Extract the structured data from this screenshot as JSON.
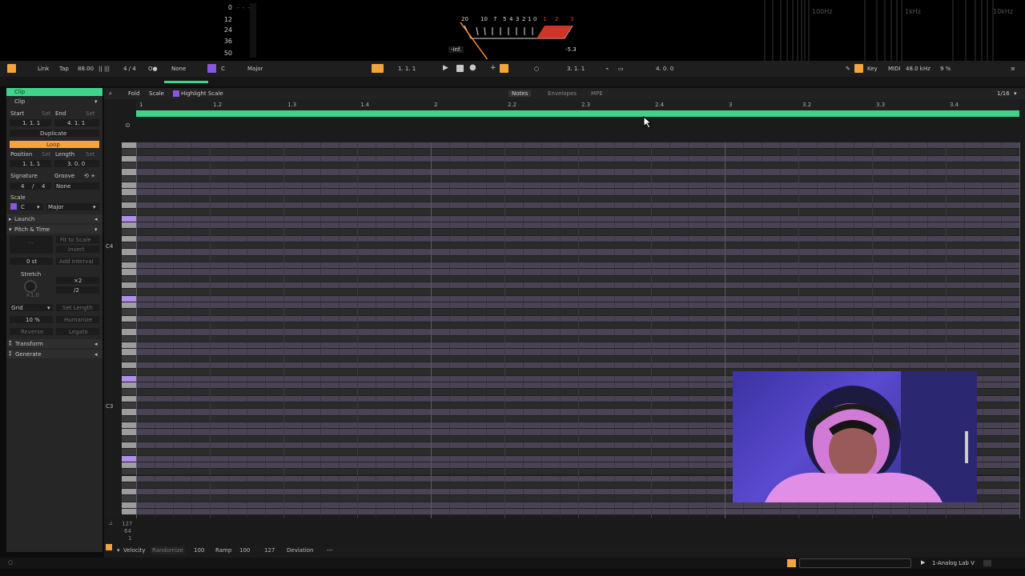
{
  "meters": {
    "db_scale": [
      "0",
      "12",
      "24",
      "36",
      "50"
    ],
    "db_top_tick": "- - -",
    "vu_scale": [
      "20",
      "10",
      "7",
      "5",
      "4",
      "3",
      "2",
      "1",
      "0",
      "1",
      "2",
      "3"
    ],
    "vu_left_value": "-inf.",
    "vu_right_value": "-5.3",
    "spectrum_labels": [
      "100Hz",
      "1kHz",
      "10kHz"
    ]
  },
  "control_bar": {
    "link": "Link",
    "tap": "Tap",
    "tempo": "88.00",
    "meter_icons": "|| |||",
    "signature": "4 / 4",
    "metronome": "O●",
    "quantize": "None",
    "key": "C",
    "scale": "Major",
    "arrangement_position": "1.   1.   1",
    "loop_start": "3.   1.   1",
    "loop_length": "4.   0.   0",
    "key_label": "Key",
    "midi_label": "MIDI",
    "sample_rate": "48.0 kHz",
    "cpu": "9 %"
  },
  "clip_panel": {
    "header": "Clip",
    "section_clip": "Clip",
    "start_label": "Start",
    "set1": "Set",
    "end_label": "End",
    "set2": "Set",
    "start_value": "1.   1.   1",
    "end_value": "4.   1.   1",
    "duplicate": "Duplicate",
    "loop": "Loop",
    "position_label": "Position",
    "set3": "Set",
    "length_label": "Length",
    "set4": "Set",
    "position_value": "1.   1.   1",
    "length_value": "3.   0.   0",
    "signature_label": "Signature",
    "groove_label": "Groove",
    "sig_num": "4",
    "sig_slash": "/",
    "sig_den": "4",
    "groove_value": "None",
    "scale_label": "Scale",
    "scale_root": "C",
    "scale_name": "Major",
    "launch": "Launch",
    "pitch_time": "Pitch & Time",
    "fit_to_scale": "Fit to Scale",
    "invert": "Invert",
    "semitones": "0 st",
    "add_interval": "Add Interval",
    "stretch": "Stretch",
    "times2": "×2",
    "div2": "/2",
    "stretch_value": "×1.0",
    "grid": "Grid",
    "set_length": "Set Length",
    "humanize_amount": "10 %",
    "humanize": "Humanize",
    "reverse": "Reverse",
    "legato": "Legato",
    "transform": "Transform",
    "generate": "Generate"
  },
  "editor": {
    "fold": "Fold",
    "scale": "Scale",
    "highlight_scale": "Highlight Scale",
    "tabs": [
      "Notes",
      "Envelopes",
      "MPE"
    ],
    "grid_value": "1/16",
    "ruler": [
      "1",
      "1.2",
      "1.3",
      "1.4",
      "2",
      "2.2",
      "2.3",
      "2.4",
      "3",
      "3.2",
      "3.3",
      "3.4"
    ],
    "note_c4": "C4",
    "note_c3": "C3"
  },
  "velocity": {
    "max": "127",
    "mid": "64",
    "min": "1",
    "velocity_label": "Velocity",
    "randomize": "Randomize",
    "velocity_value": "100",
    "ramp_label": "Ramp",
    "ramp_from": "100",
    "ramp_to": "127",
    "deviation_label": "Deviation",
    "deviation_value": "---"
  },
  "status_bar": {
    "track_name": "1-Analog Lab V"
  },
  "colors": {
    "accent_green": "#3fd48a",
    "accent_orange": "#f5a33a",
    "note_purple": "#b38cf0",
    "scale_lane": "#4a4356"
  }
}
